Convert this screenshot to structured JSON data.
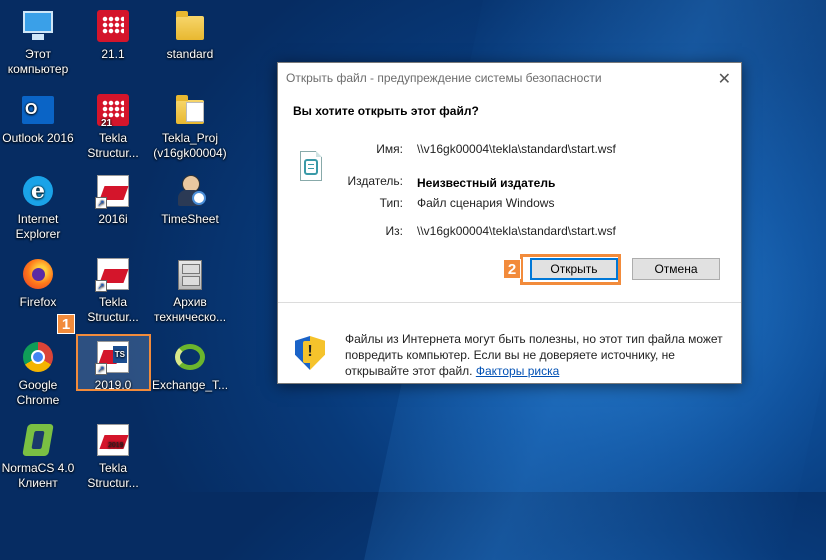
{
  "desktop": {
    "icons": [
      {
        "label": "Этот\nкомпьютер"
      },
      {
        "label": "21.1"
      },
      {
        "label": "standard"
      },
      {
        "label": "Outlook 2016"
      },
      {
        "label": "Tekla\nStructur..."
      },
      {
        "label": "Tekla_Proj\n(v16gk00004)"
      },
      {
        "label": "Internet\nExplorer"
      },
      {
        "label": "2016i"
      },
      {
        "label": "TimeSheet"
      },
      {
        "label": "Firefox"
      },
      {
        "label": "Tekla\nStructur..."
      },
      {
        "label": "Архив\nтехническо..."
      },
      {
        "label": "Google\nChrome"
      },
      {
        "label": "2019.0"
      },
      {
        "label": "Exchange_T..."
      },
      {
        "label": "NormaCS 4.0\nКлиент"
      },
      {
        "label": "Tekla\nStructur..."
      }
    ],
    "icon_badges": {
      "ts": "TS",
      "year": "2019"
    }
  },
  "steps": {
    "one": "1",
    "two": "2"
  },
  "dialog": {
    "title": "Открыть файл - предупреждение системы безопасности",
    "close_glyph": "✕",
    "question": "Вы хотите открыть этот файл?",
    "fields": {
      "name_label": "Имя:",
      "name_value": "\\\\v16gk00004\\tekla\\standard\\start.wsf",
      "publisher_label": "Издатель:",
      "publisher_value": "Неизвестный издатель",
      "type_label": "Тип:",
      "type_value": "Файл сценария Windows",
      "from_label": "Из:",
      "from_value": "\\\\v16gk00004\\tekla\\standard\\start.wsf"
    },
    "open_button": "Открыть",
    "cancel_button": "Отмена",
    "warning_text": "Файлы из Интернета могут быть полезны, но этот тип файла может повредить компьютер. Если вы не доверяете источнику, не открывайте этот файл.",
    "risk_link": "Факторы риска"
  },
  "colors": {
    "highlight": "#f28b3b",
    "link": "#0050b4",
    "focus": "#0078d7"
  }
}
